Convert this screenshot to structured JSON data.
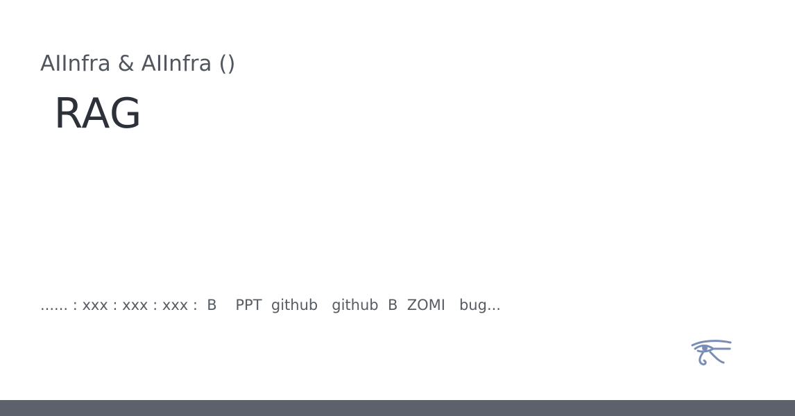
{
  "header": {
    "site_name": "AIInfra & AIInfra (￼￼￼￼￼￼￼)",
    "title": "￼￼￼￼￼￼￼ RAG ￼"
  },
  "content": {
    "description": "￼￼￼￼￼￼￼￼￼......  ￼￼￼￼: xxx  ￼￼￼￼: xxx  ￼￼￼￼: xxx  ￼￼: ￼￼￼￼￼￼ B ￼ ￼ ￼￼ ￼PPT ￼￼￼ github ￼￼￼￼￼￼￼ ￼￼￼￼￼￼￼￼￼￼￼￼￼￼￼￼￼ github ￼￼￼￼￼ B ￼￼ ZOMI ￼￼￼￼ ￼￼￼￼￼￼￼￼￼￼￼￼￼￼ bug..."
  },
  "logo": {
    "icon": "eye-of-horus-icon",
    "color": "#7a8db5"
  },
  "theme": {
    "footer_color": "#5c616b"
  }
}
